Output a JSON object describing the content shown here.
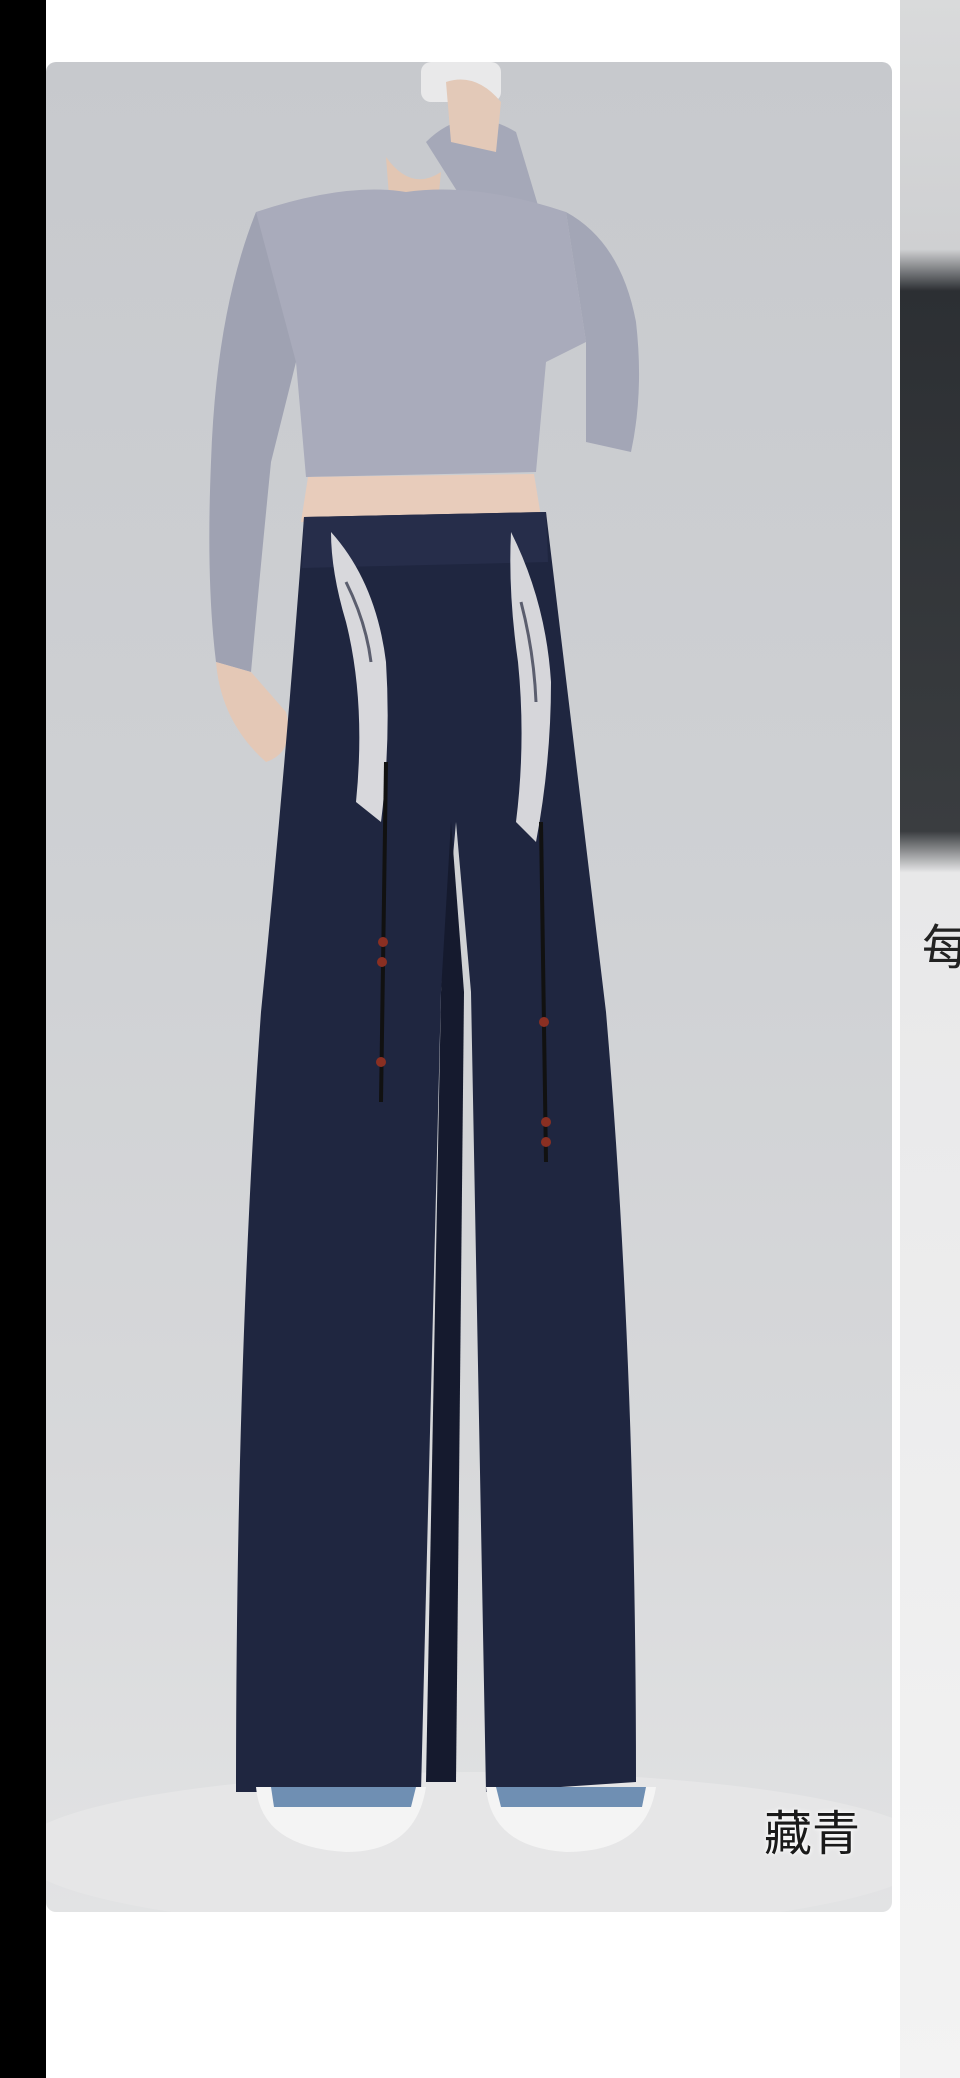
{
  "product": {
    "title_text": "",
    "color_label": "藏青"
  },
  "next_card": {
    "peek_glyph": "每"
  },
  "colors": {
    "pants": "#1f2640",
    "top": "#a9abbb",
    "background": "#cbcdd1"
  }
}
